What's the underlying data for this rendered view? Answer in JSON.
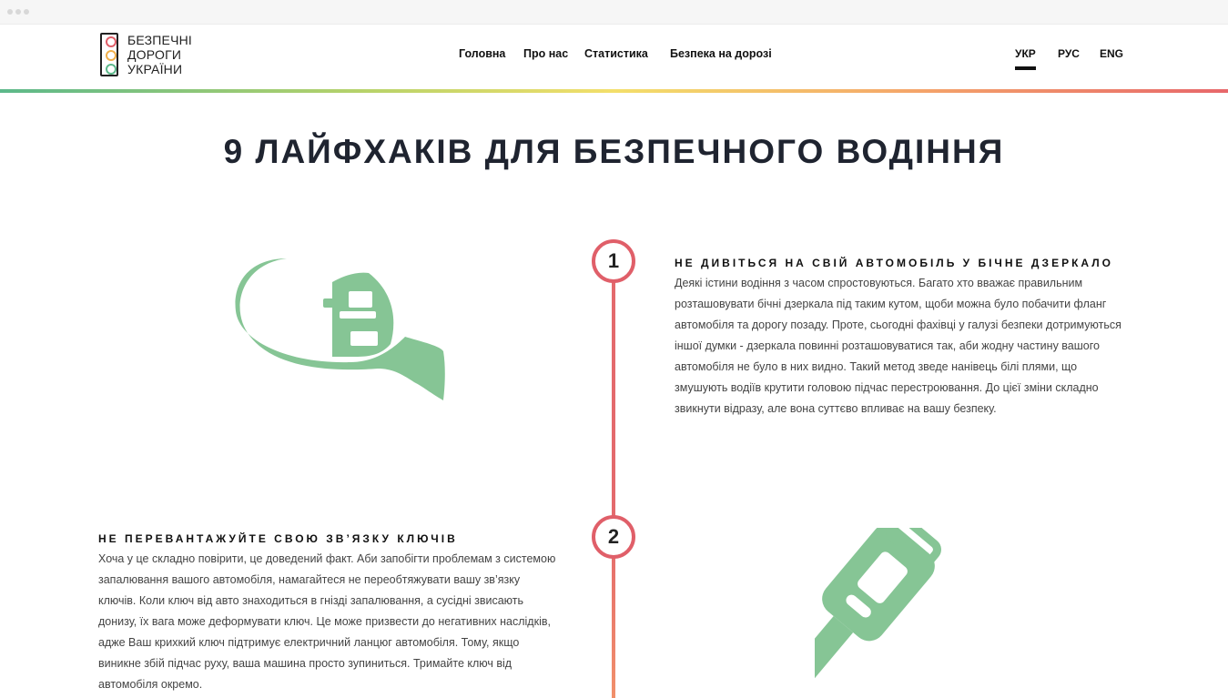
{
  "brand": {
    "line1": "БЕЗПЕЧНІ",
    "line2": "ДОРОГИ",
    "line3": "УКРАЇНИ",
    "lamp_colors": [
      "#e05f69",
      "#f2b04a",
      "#5cb88a"
    ]
  },
  "nav": {
    "items": [
      "Головна",
      "Про нас",
      "Статистика",
      "Безпека на дорозі"
    ]
  },
  "languages": {
    "items": [
      "УКР",
      "РУС",
      "ENG"
    ],
    "active": "УКР"
  },
  "page": {
    "title": "9 ЛАЙФХАКІВ ДЛЯ БЕЗПЕЧНОГО ВОДІННЯ"
  },
  "tips": [
    {
      "number": "1",
      "title": "Не дивіться на свій автомобіль у бічне дзеркало",
      "body": "Деякі істини водіння з часом спростовуються. Багато хто вважає правильним розташовувати бічні дзеркала під таким кутом, щоби можна було побачити фланг автомобіля та дорогу позаду. Проте, сьогодні фахівці у галузі безпеки дотримуються іншої думки - дзеркала повинні розташовуватися так, аби жодну частину вашого автомобіля не було в них видно. Такий метод зведе нанівець білі плями, що змушують водіїв крутити головою підчас перестроювання. До цієї зміни складно звикнути відразу, але вона суттєво впливає на вашу безпеку.",
      "icon": "side-mirror-car-icon"
    },
    {
      "number": "2",
      "title": "Не перевантажуйте свою зв’язку ключів",
      "body": "Хоча у це складно повірити, це доведений факт. Аби запобігти проблемам з системою запалювання вашого автомобіля, намагайтеся не переобтяжувати вашу зв’язку ключів. Коли ключ від авто знаходиться в гнізді запалювання, а сусідні звисають донизу, їх вага може деформувати ключ. Це може призвести до негативних наслідків, адже Ваш крихкий ключ підтримує електричний ланцюг автомобіля. Тому, якщо виникне збій підчас руху, ваша машина просто зупиниться. Тримайте ключ від автомобіля окремо.",
      "icon": "car-key-icon"
    }
  ],
  "colors": {
    "icon_green": "#86c595",
    "timeline_red": "#e05f69"
  }
}
